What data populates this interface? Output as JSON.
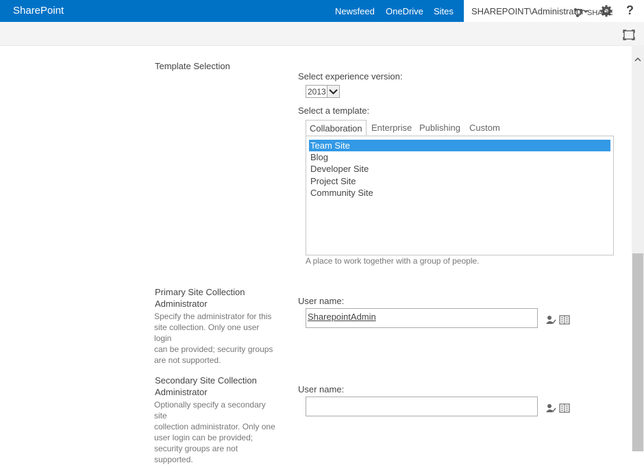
{
  "suitebar": {
    "brand": "SharePoint",
    "nav": [
      "Newsfeed",
      "OneDrive",
      "Sites"
    ],
    "user": "SHAREPOINT\\Administrator",
    "help": "?"
  },
  "ribbon": {
    "share_label": "SHARE"
  },
  "template_section": {
    "title": "Template Selection",
    "version_label": "Select experience version:",
    "version_value": "2013",
    "template_label": "Select a template:",
    "tabs": [
      "Collaboration",
      "Enterprise",
      "Publishing",
      "Custom"
    ],
    "templates": [
      "Team Site",
      "Blog",
      "Developer Site",
      "Project Site",
      "Community Site"
    ],
    "selected_description": "A place to work together with a group of people."
  },
  "primary_admin": {
    "title_line1": "Primary Site Collection",
    "title_line2": "Administrator",
    "desc_lines": [
      "Specify the administrator for this",
      "site collection. Only one user login",
      "can be provided; security groups",
      "are not supported."
    ],
    "field_label": "User name:",
    "value": "SharepointAdmin"
  },
  "secondary_admin": {
    "title_line1": "Secondary Site Collection",
    "title_line2": "Administrator",
    "desc_lines": [
      "Optionally specify a secondary site",
      "collection administrator. Only one",
      "user login can be provided;",
      "security groups are not supported."
    ],
    "field_label": "User name:",
    "value": ""
  },
  "colors": {
    "suitebar": "#0072c6",
    "selection": "#3399e6"
  }
}
